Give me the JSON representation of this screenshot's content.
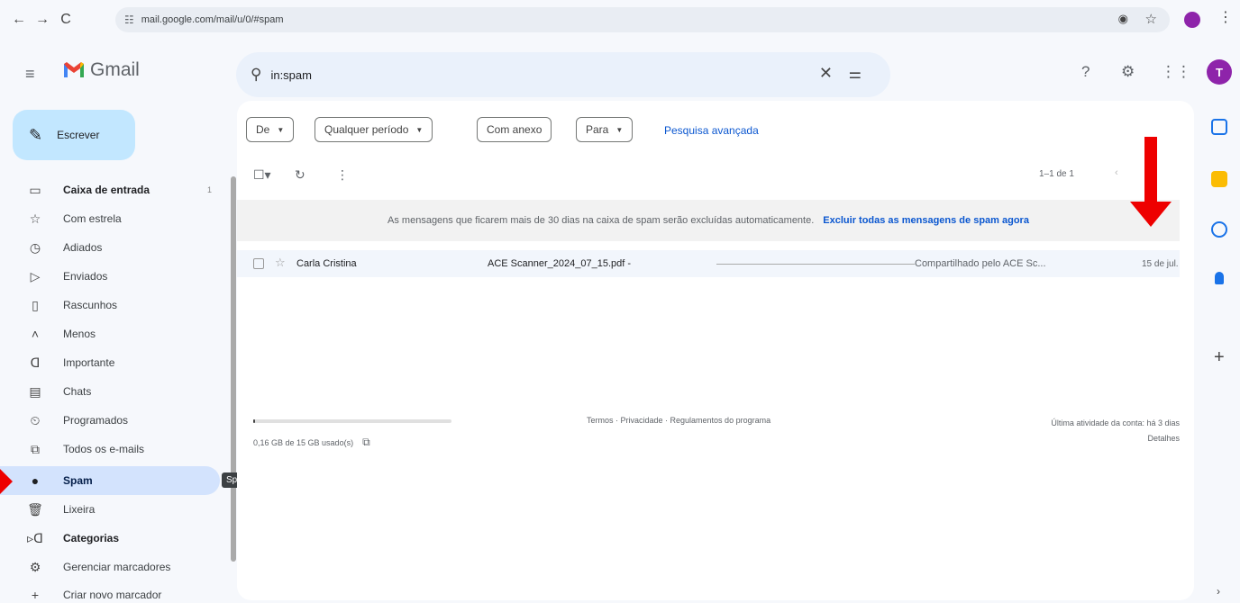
{
  "browser": {
    "url": "mail.google.com/mail/u/0/#spam",
    "back": "←",
    "forward": "→",
    "reload": "C"
  },
  "header": {
    "app_name": "Gmail",
    "search_value": "in:spam",
    "avatar_letter": "T",
    "brand_color": "#8e24aa"
  },
  "compose": {
    "label": "Escrever"
  },
  "sidebar": {
    "items": [
      {
        "label": "Caixa de entrada",
        "count": "1",
        "icon": "inbox-icon"
      },
      {
        "label": "Com estrela",
        "icon": "star-icon"
      },
      {
        "label": "Adiados",
        "icon": "clock-icon"
      },
      {
        "label": "Enviados",
        "icon": "send-icon"
      },
      {
        "label": "Rascunhos",
        "icon": "draft-icon"
      },
      {
        "label": "Menos",
        "icon": "chevron-up-icon"
      },
      {
        "label": "Importante",
        "icon": "important-icon"
      },
      {
        "label": "Chats",
        "icon": "chat-icon"
      },
      {
        "label": "Programados",
        "icon": "scheduled-icon"
      },
      {
        "label": "Todos os e-mails",
        "icon": "all-mail-icon"
      },
      {
        "label": "Spam",
        "icon": "spam-icon"
      },
      {
        "label": "Lixeira",
        "icon": "trash-icon"
      },
      {
        "label": "Categorias",
        "icon": "label-icon"
      },
      {
        "label": "Gerenciar marcadores",
        "icon": "gear-icon"
      },
      {
        "label": "Criar novo marcador",
        "icon": "plus-icon"
      }
    ],
    "tooltip": "Spam"
  },
  "filters": {
    "from": "De",
    "period": "Qualquer período",
    "attachment": "Com anexo",
    "to": "Para",
    "advanced": "Pesquisa avançada"
  },
  "toolbar": {
    "page_info": "1–1 de 1"
  },
  "banner": {
    "text": "As mensagens que ficarem mais de 30 dias na caixa de spam serão excluídas automaticamente.",
    "link": "Excluir todas as mensagens de spam agora"
  },
  "emails": [
    {
      "sender": "Carla Cristina",
      "subject": "ACE Scanner_2024_07_15.pdf -",
      "snippet": "Compartilhado pelo ACE Sc...",
      "date": "15 de jul."
    }
  ],
  "footer": {
    "storage": "0,16 GB de 15 GB usado(s)",
    "storage_fraction": 0.01,
    "links": "Termos · Privacidade · Regulamentos do programa",
    "last_activity": "Última atividade da conta: há 3 dias",
    "details": "Detalhes"
  }
}
